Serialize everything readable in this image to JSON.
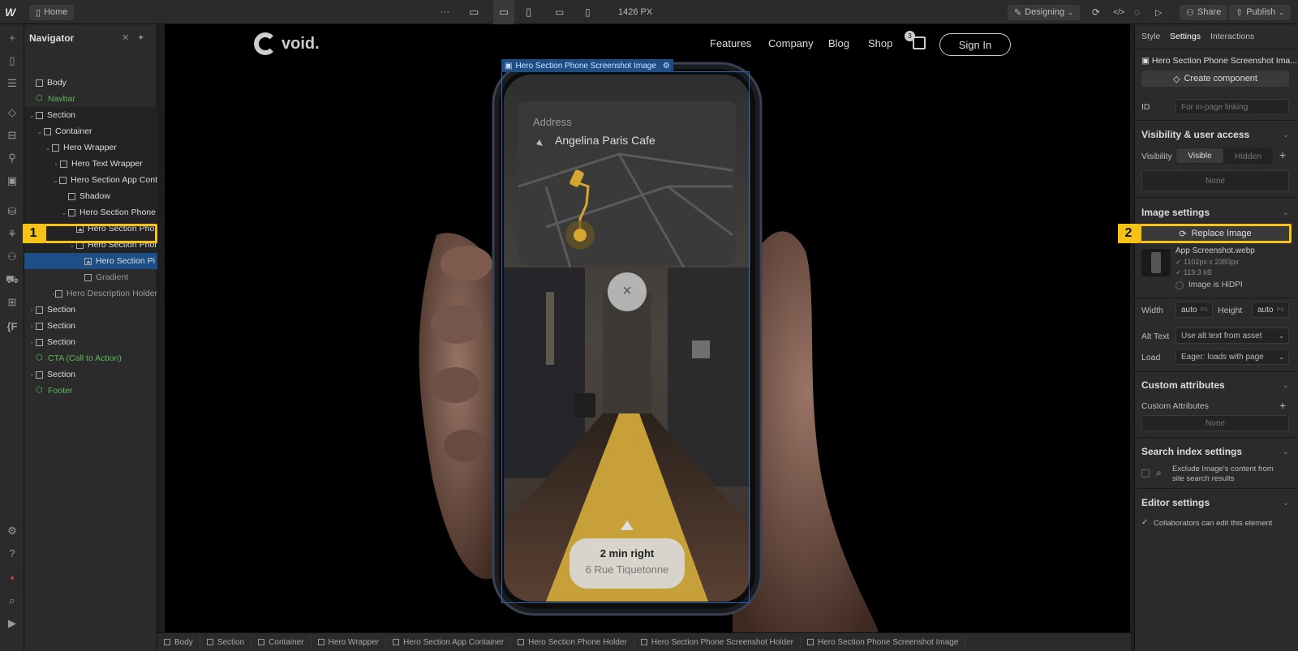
{
  "topbar": {
    "home_label": "Home",
    "more": "···",
    "width_readout": "1426 PX",
    "mode": "Designing",
    "share": "Share",
    "publish": "Publish"
  },
  "navigator": {
    "title": "Navigator",
    "items": [
      {
        "label": "Body",
        "depth": 0,
        "caret": "",
        "icon": "box",
        "style": ""
      },
      {
        "label": "Navbar",
        "depth": 0,
        "caret": "",
        "icon": "component",
        "style": "green"
      },
      {
        "label": "Section",
        "depth": 0,
        "caret": "⌄",
        "icon": "box",
        "style": "hl"
      },
      {
        "label": "Container",
        "depth": 1,
        "caret": "⌄",
        "icon": "box",
        "style": "hl"
      },
      {
        "label": "Hero Wrapper",
        "depth": 2,
        "caret": "⌄",
        "icon": "box",
        "style": "hl"
      },
      {
        "label": "Hero Text Wrapper",
        "depth": 3,
        "caret": "›",
        "icon": "box",
        "style": "hl"
      },
      {
        "label": "Hero Section App Cont",
        "depth": 3,
        "caret": "⌄",
        "icon": "box",
        "style": "hl"
      },
      {
        "label": "Shadow",
        "depth": 4,
        "caret": "",
        "icon": "box",
        "style": "hl"
      },
      {
        "label": "Hero Section Phone",
        "depth": 4,
        "caret": "⌄",
        "icon": "box",
        "style": "hl"
      },
      {
        "label": "Hero Section Phor",
        "depth": 5,
        "caret": "",
        "icon": "image",
        "style": "hl"
      },
      {
        "label": "Hero Section Phor",
        "depth": 5,
        "caret": "⌄",
        "icon": "box",
        "style": "hl"
      },
      {
        "label": "Hero Section Pi",
        "depth": 6,
        "caret": "",
        "icon": "image",
        "style": "sel"
      },
      {
        "label": "Gradient",
        "depth": 6,
        "caret": "",
        "icon": "box",
        "style": "faded"
      },
      {
        "label": "Hero Description Holder",
        "depth": 3,
        "caret": "›",
        "icon": "box",
        "style": "faded"
      },
      {
        "label": "Section",
        "depth": 0,
        "caret": "›",
        "icon": "box",
        "style": ""
      },
      {
        "label": "Section",
        "depth": 0,
        "caret": "›",
        "icon": "box",
        "style": ""
      },
      {
        "label": "Section",
        "depth": 0,
        "caret": "›",
        "icon": "box",
        "style": ""
      },
      {
        "label": "CTA (Call to Action)",
        "depth": 0,
        "caret": "",
        "icon": "component",
        "style": "green"
      },
      {
        "label": "Section",
        "depth": 0,
        "caret": "›",
        "icon": "box",
        "style": ""
      },
      {
        "label": "Footer",
        "depth": 0,
        "caret": "",
        "icon": "component",
        "style": "green"
      }
    ]
  },
  "annotations": {
    "a1": "1",
    "a2": "2"
  },
  "site": {
    "logo": "void.",
    "nav": [
      "Features",
      "Company",
      "Blog",
      "Shop"
    ],
    "cart_count": "3",
    "signin": "Sign In"
  },
  "selection_label": "Hero Section Phone Screenshot Image",
  "app": {
    "address_label": "Address",
    "address_value": "Angelina Paris Cafe",
    "direction": "2 min right",
    "street": "6 Rue Tiquetonne",
    "close": "×"
  },
  "breadcrumbs": [
    "Body",
    "Section",
    "Container",
    "Hero Wrapper",
    "Hero Section App Container",
    "Hero Section Phone Holder",
    "Hero Section Phone Screenshot Holder",
    "Hero Section Phone Screenshot Image"
  ],
  "panel": {
    "tabs": [
      "Style",
      "Settings",
      "Interactions"
    ],
    "element_name": "Hero Section Phone Screenshot Ima...",
    "create_component": "Create component",
    "id_label": "ID",
    "id_placeholder": "For in-page linking",
    "visibility_header": "Visibility & user access",
    "visibility_label": "Visibility",
    "visible": "Visible",
    "hidden": "Hidden",
    "none": "None",
    "image_header": "Image settings",
    "replace": "Replace Image",
    "file_name": "App Screenshot.webp",
    "file_dims": "1102px x 2383px",
    "file_size": "119.3 kB",
    "hidpi": "Image is HiDPI",
    "width_label": "Width",
    "width_value": "auto",
    "height_label": "Height",
    "height_value": "auto",
    "unit": "PX",
    "alt_label": "Alt Text",
    "alt_value": "Use alt text from asset",
    "load_label": "Load",
    "load_value": "Eager: loads with page",
    "custom_header": "Custom attributes",
    "custom_label": "Custom Attributes",
    "custom_none": "None",
    "search_header": "Search index settings",
    "search_text_1": "Exclude Image's content from",
    "search_text_2": "site search results",
    "editor_header": "Editor settings",
    "editor_text": "Collaborators can edit this element"
  },
  "colors": {
    "accent": "#f6c218",
    "selection": "#1d4f86",
    "component": "#5cb85c",
    "panel": "#2b2b2b"
  }
}
